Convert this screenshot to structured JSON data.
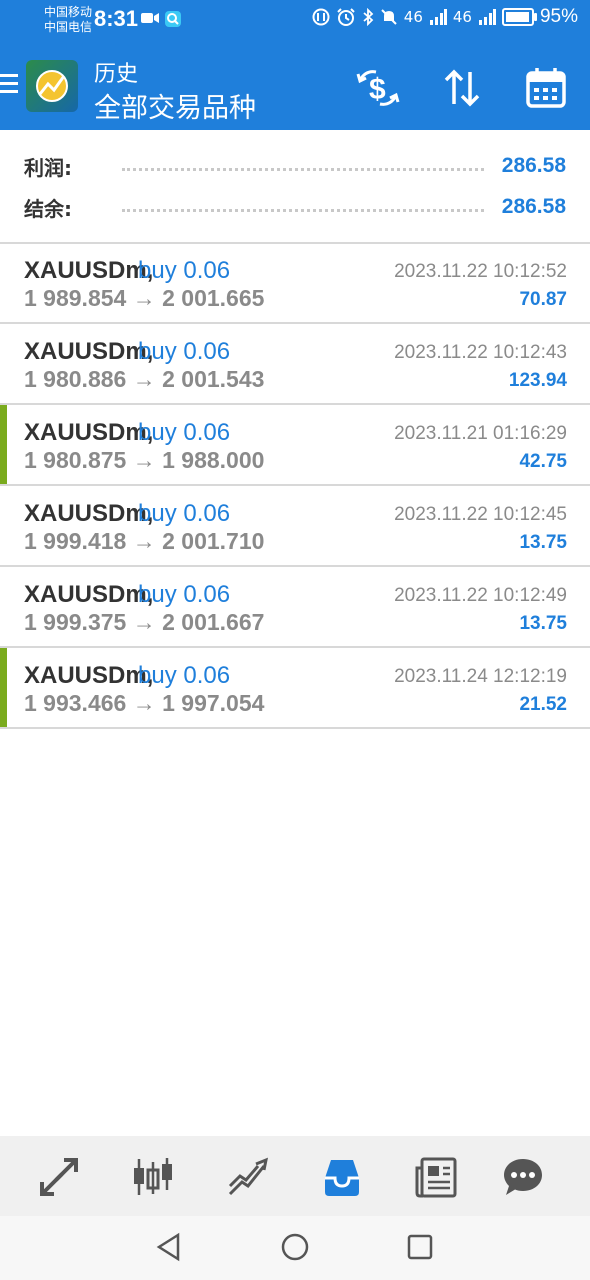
{
  "status_bar": {
    "carrier1": "中国移动",
    "carrier2": "中国电信",
    "time": "8:31",
    "network1": "46",
    "network2": "46",
    "battery_percent": 95,
    "battery_text": "95%"
  },
  "app_bar": {
    "title": "历史",
    "subtitle": "全部交易品种",
    "accent_color": "#1f7fdb"
  },
  "summary": {
    "profit_label": "利润:",
    "profit_value": "286.58",
    "balance_label": "结余:",
    "balance_value": "286.58"
  },
  "deals": [
    {
      "symbol": "XAUUSDm,",
      "side": "buy 0.06",
      "prices": "1 989.854 → 2 001.665",
      "time": "2023.11.22 10:12:52",
      "profit": "70.87",
      "marked": false
    },
    {
      "symbol": "XAUUSDm,",
      "side": "buy 0.06",
      "prices": "1 980.886 → 2 001.543",
      "time": "2023.11.22 10:12:43",
      "profit": "123.94",
      "marked": false
    },
    {
      "symbol": "XAUUSDm,",
      "side": "buy 0.06",
      "prices": "1 980.875 → 1 988.000",
      "time": "2023.11.21 01:16:29",
      "profit": "42.75",
      "marked": true
    },
    {
      "symbol": "XAUUSDm,",
      "side": "buy 0.06",
      "prices": "1 999.418 → 2 001.710",
      "time": "2023.11.22 10:12:45",
      "profit": "13.75",
      "marked": false
    },
    {
      "symbol": "XAUUSDm,",
      "side": "buy 0.06",
      "prices": "1 999.375 → 2 001.667",
      "time": "2023.11.22 10:12:49",
      "profit": "13.75",
      "marked": false
    },
    {
      "symbol": "XAUUSDm,",
      "side": "buy 0.06",
      "prices": "1 993.466 → 1 997.054",
      "time": "2023.11.24 12:12:19",
      "profit": "21.52",
      "marked": true
    }
  ],
  "tabs": [
    "quotes-icon",
    "chart-icon",
    "trade-icon",
    "history-icon",
    "news-icon",
    "chat-icon"
  ],
  "active_tab": "history-icon"
}
